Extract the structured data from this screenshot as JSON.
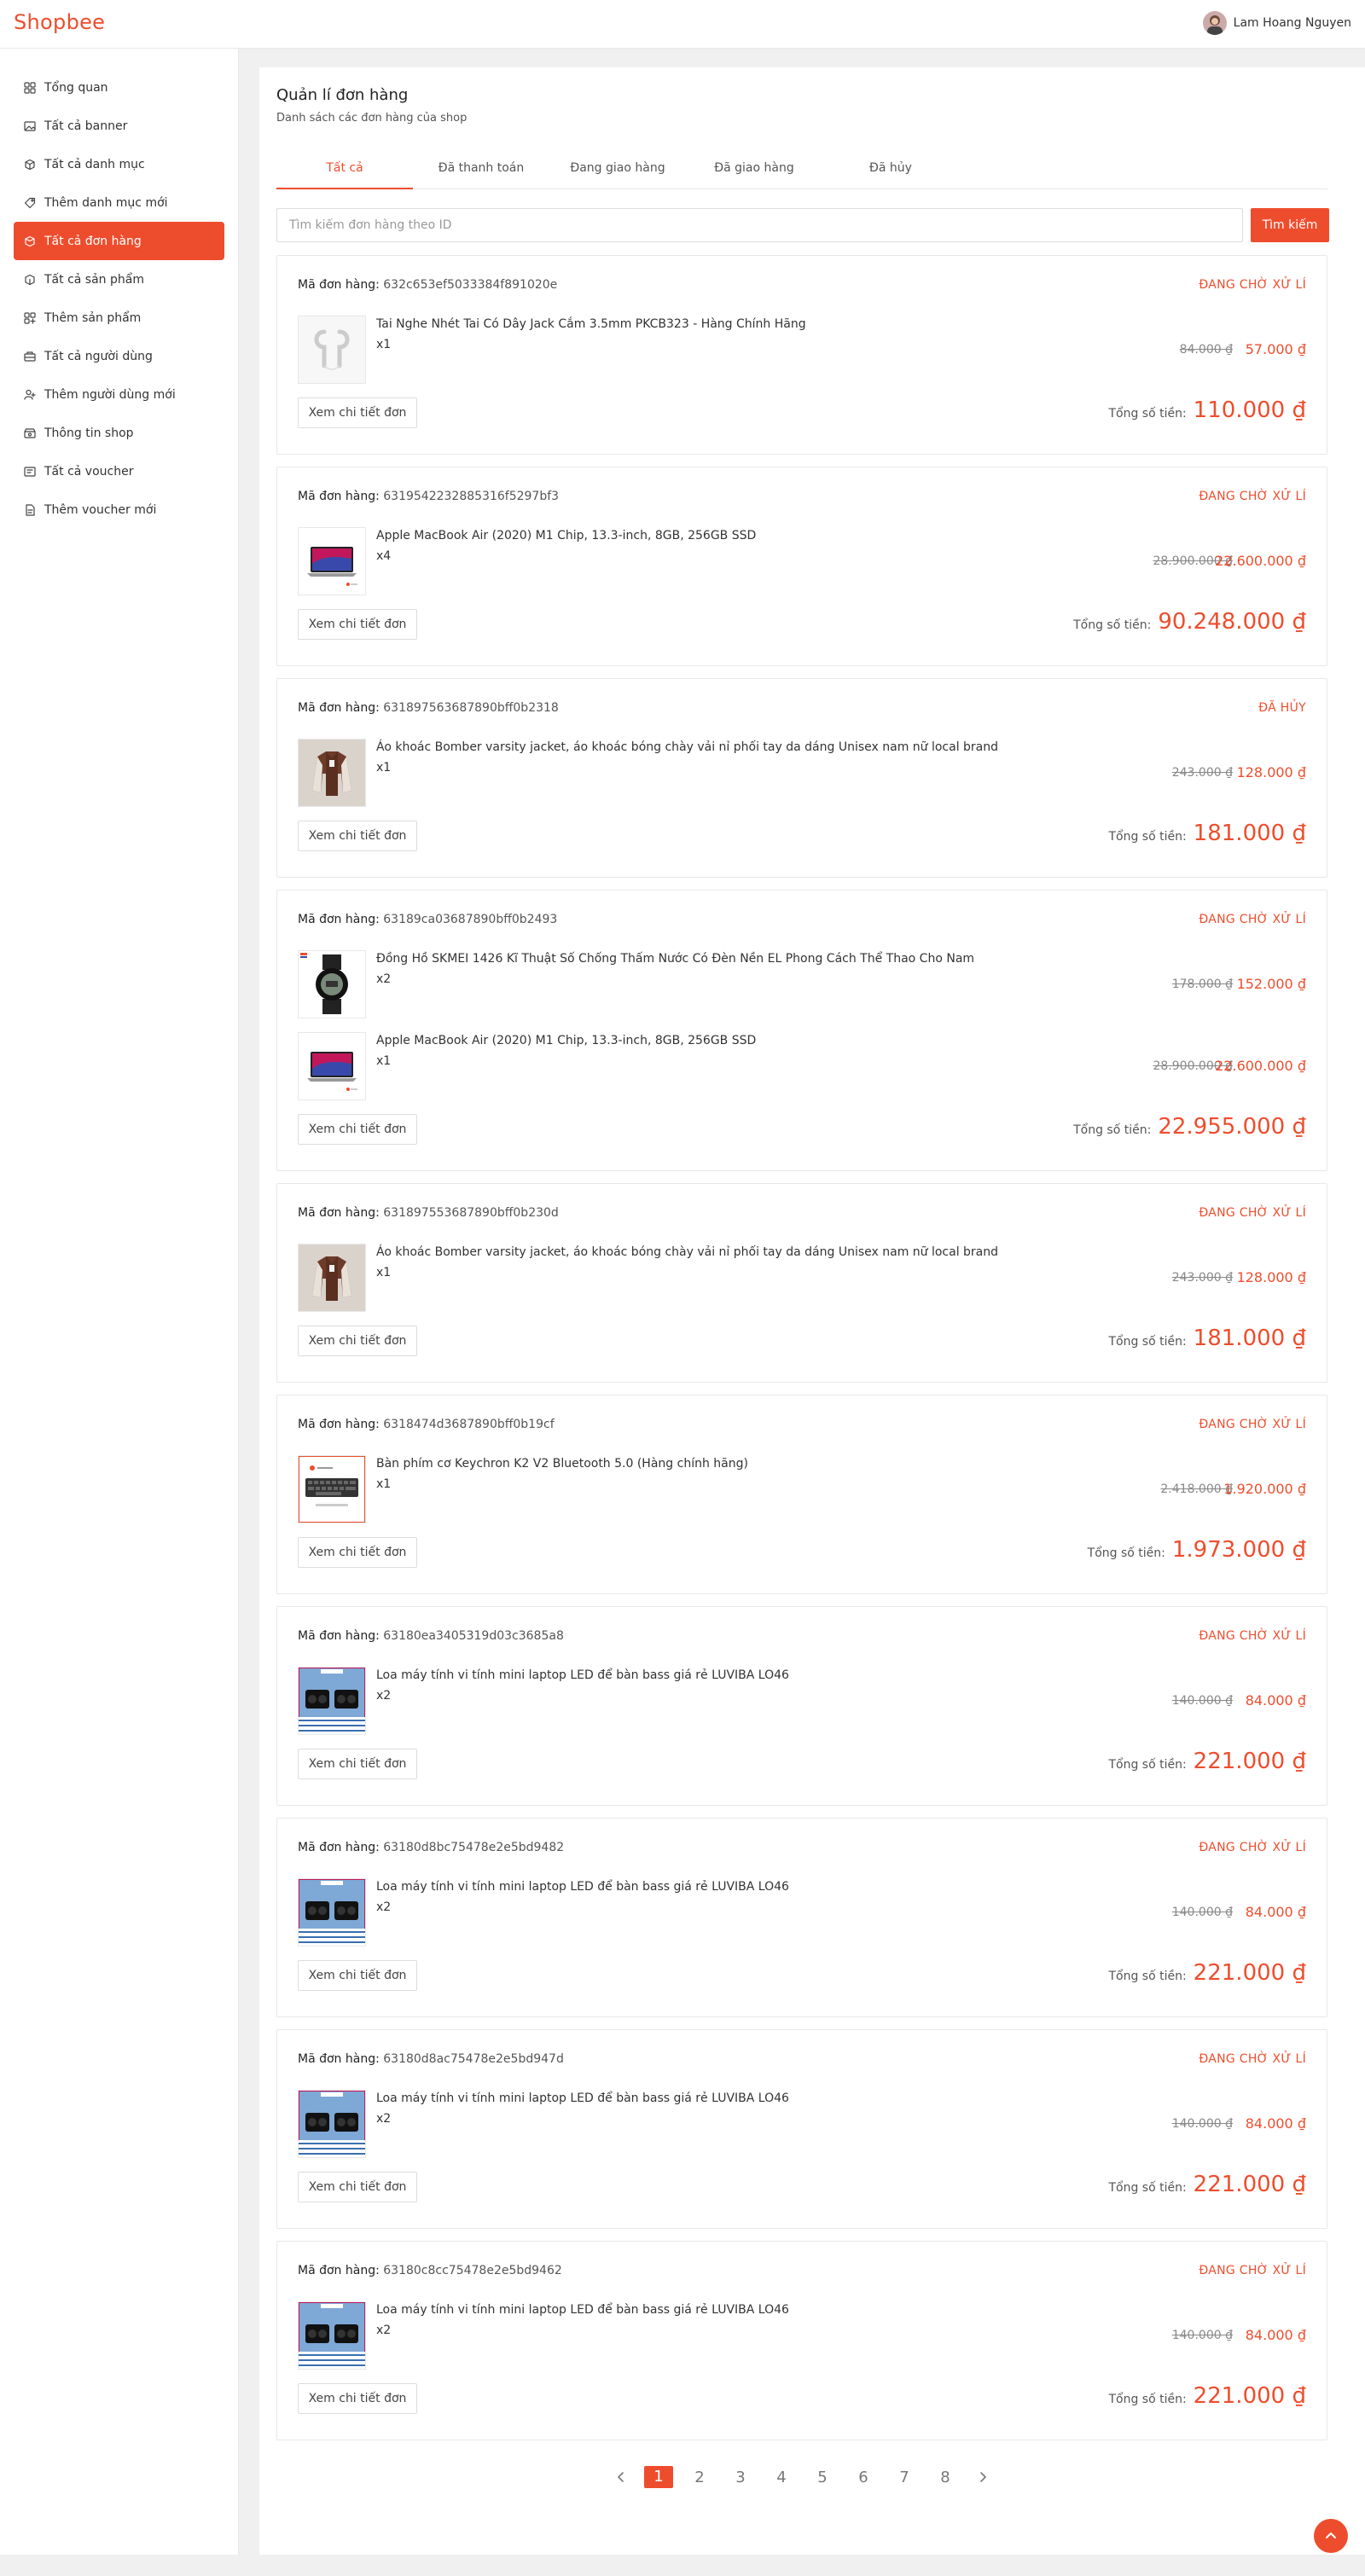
{
  "app": {
    "brand": "Shopbee",
    "accent": "#ee4d2d"
  },
  "user": {
    "name": "Lam Hoang Nguyen"
  },
  "sidebar": {
    "items": [
      {
        "label": "Tổng quan",
        "icon": "dashboard-icon"
      },
      {
        "label": "Tất cả banner",
        "icon": "image-icon"
      },
      {
        "label": "Tất cả danh mục",
        "icon": "box-icon"
      },
      {
        "label": "Thêm danh mục mới",
        "icon": "tag-icon"
      },
      {
        "label": "Tất cả đơn hàng",
        "icon": "orders-icon",
        "active": true
      },
      {
        "label": "Tất cả sản phẩm",
        "icon": "product-icon"
      },
      {
        "label": "Thêm sản phẩm",
        "icon": "add-product-icon"
      },
      {
        "label": "Tất cả người dùng",
        "icon": "users-icon"
      },
      {
        "label": "Thêm người dùng mới",
        "icon": "add-user-icon"
      },
      {
        "label": "Thông tin shop",
        "icon": "shop-icon"
      },
      {
        "label": "Tất cả voucher",
        "icon": "voucher-icon"
      },
      {
        "label": "Thêm voucher mới",
        "icon": "add-voucher-icon"
      }
    ]
  },
  "page": {
    "title": "Quản lí đơn hàng",
    "subtitle": "Danh sách các đơn hàng của shop"
  },
  "tabs": [
    "Tất cả",
    "Đã thanh toán",
    "Đang giao hàng",
    "Đã giao hàng",
    "Đã hủy"
  ],
  "search": {
    "placeholder": "Tìm kiếm đơn hàng theo ID",
    "value": "",
    "button": "Tìm kiếm"
  },
  "labels": {
    "order_id": "Mã đơn hàng:",
    "detail_button": "Xem chi tiết đơn",
    "total": "Tổng số tiền:"
  },
  "orders": [
    {
      "id": "632c653ef5033384f891020e",
      "status": "ĐANG CHỜ XỬ LÍ",
      "items": [
        {
          "name": "Tai Nghe Nhét Tai Có Dây Jack Cắm 3.5mm PKCB323 - Hàng Chính Hãng",
          "qty": "x1",
          "old_price": "84.000 ₫",
          "price": "57.000 ₫",
          "thumb": "earphones"
        }
      ],
      "total": "110.000 ₫"
    },
    {
      "id": "6319542232885316f5297bf3",
      "status": "ĐANG CHỜ XỬ LÍ",
      "items": [
        {
          "name": "Apple MacBook Air (2020) M1 Chip, 13.3-inch, 8GB, 256GB SSD",
          "qty": "x4",
          "old_price": "28.900.000 ₫",
          "price": "22.600.000 ₫",
          "thumb": "laptop"
        }
      ],
      "total": "90.248.000 ₫"
    },
    {
      "id": "631897563687890bff0b2318",
      "status": "ĐÃ HỦY",
      "items": [
        {
          "name": "Áo khoác Bomber varsity jacket, áo khoác bóng chày vải nỉ phối tay da dáng Unisex nam nữ local brand",
          "qty": "x1",
          "old_price": "243.000 ₫",
          "price": "128.000 ₫",
          "thumb": "jacket"
        }
      ],
      "total": "181.000 ₫"
    },
    {
      "id": "63189ca03687890bff0b2493",
      "status": "ĐANG CHỜ XỬ LÍ",
      "items": [
        {
          "name": "Đồng Hồ SKMEI 1426 Kĩ Thuật Số Chống Thấm Nước Có Đèn Nền EL Phong Cách Thể Thao Cho Nam",
          "qty": "x2",
          "old_price": "178.000 ₫",
          "price": "152.000 ₫",
          "thumb": "watch"
        },
        {
          "name": "Apple MacBook Air (2020) M1 Chip, 13.3-inch, 8GB, 256GB SSD",
          "qty": "x1",
          "old_price": "28.900.000 ₫",
          "price": "22.600.000 ₫",
          "thumb": "laptop"
        }
      ],
      "total": "22.955.000 ₫"
    },
    {
      "id": "631897553687890bff0b230d",
      "status": "ĐANG CHỜ XỬ LÍ",
      "items": [
        {
          "name": "Áo khoác Bomber varsity jacket, áo khoác bóng chày vải nỉ phối tay da dáng Unisex nam nữ local brand",
          "qty": "x1",
          "old_price": "243.000 ₫",
          "price": "128.000 ₫",
          "thumb": "jacket"
        }
      ],
      "total": "181.000 ₫"
    },
    {
      "id": "6318474d3687890bff0b19cf",
      "status": "ĐANG CHỜ XỬ LÍ",
      "items": [
        {
          "name": "Bàn phím cơ Keychron K2 V2 Bluetooth 5.0 (Hàng chính hãng)",
          "qty": "x1",
          "old_price": "2.418.000 ₫",
          "price": "1.920.000 ₫",
          "thumb": "keyboard"
        }
      ],
      "total": "1.973.000 ₫"
    },
    {
      "id": "63180ea3405319d03c3685a8",
      "status": "ĐANG CHỜ XỬ LÍ",
      "items": [
        {
          "name": "Loa máy tính vi tính mini laptop LED để bàn bass giá rẻ LUVIBA LO46",
          "qty": "x2",
          "old_price": "140.000 ₫",
          "price": "84.000 ₫",
          "thumb": "speaker"
        }
      ],
      "total": "221.000 ₫"
    },
    {
      "id": "63180d8bc75478e2e5bd9482",
      "status": "ĐANG CHỜ XỬ LÍ",
      "items": [
        {
          "name": "Loa máy tính vi tính mini laptop LED để bàn bass giá rẻ LUVIBA LO46",
          "qty": "x2",
          "old_price": "140.000 ₫",
          "price": "84.000 ₫",
          "thumb": "speaker"
        }
      ],
      "total": "221.000 ₫"
    },
    {
      "id": "63180d8ac75478e2e5bd947d",
      "status": "ĐANG CHỜ XỬ LÍ",
      "items": [
        {
          "name": "Loa máy tính vi tính mini laptop LED để bàn bass giá rẻ LUVIBA LO46",
          "qty": "x2",
          "old_price": "140.000 ₫",
          "price": "84.000 ₫",
          "thumb": "speaker"
        }
      ],
      "total": "221.000 ₫"
    },
    {
      "id": "63180c8cc75478e2e5bd9462",
      "status": "ĐANG CHỜ XỬ LÍ",
      "items": [
        {
          "name": "Loa máy tính vi tính mini laptop LED để bàn bass giá rẻ LUVIBA LO46",
          "qty": "x2",
          "old_price": "140.000 ₫",
          "price": "84.000 ₫",
          "thumb": "speaker"
        }
      ],
      "total": "221.000 ₫"
    }
  ],
  "pagination": {
    "pages": [
      "1",
      "2",
      "3",
      "4",
      "5",
      "6",
      "7",
      "8"
    ],
    "current": "1",
    "prev_icon": "chevron-left-icon",
    "next_icon": "chevron-right-icon"
  },
  "scroll_top": {
    "icon": "chevron-up-icon"
  }
}
